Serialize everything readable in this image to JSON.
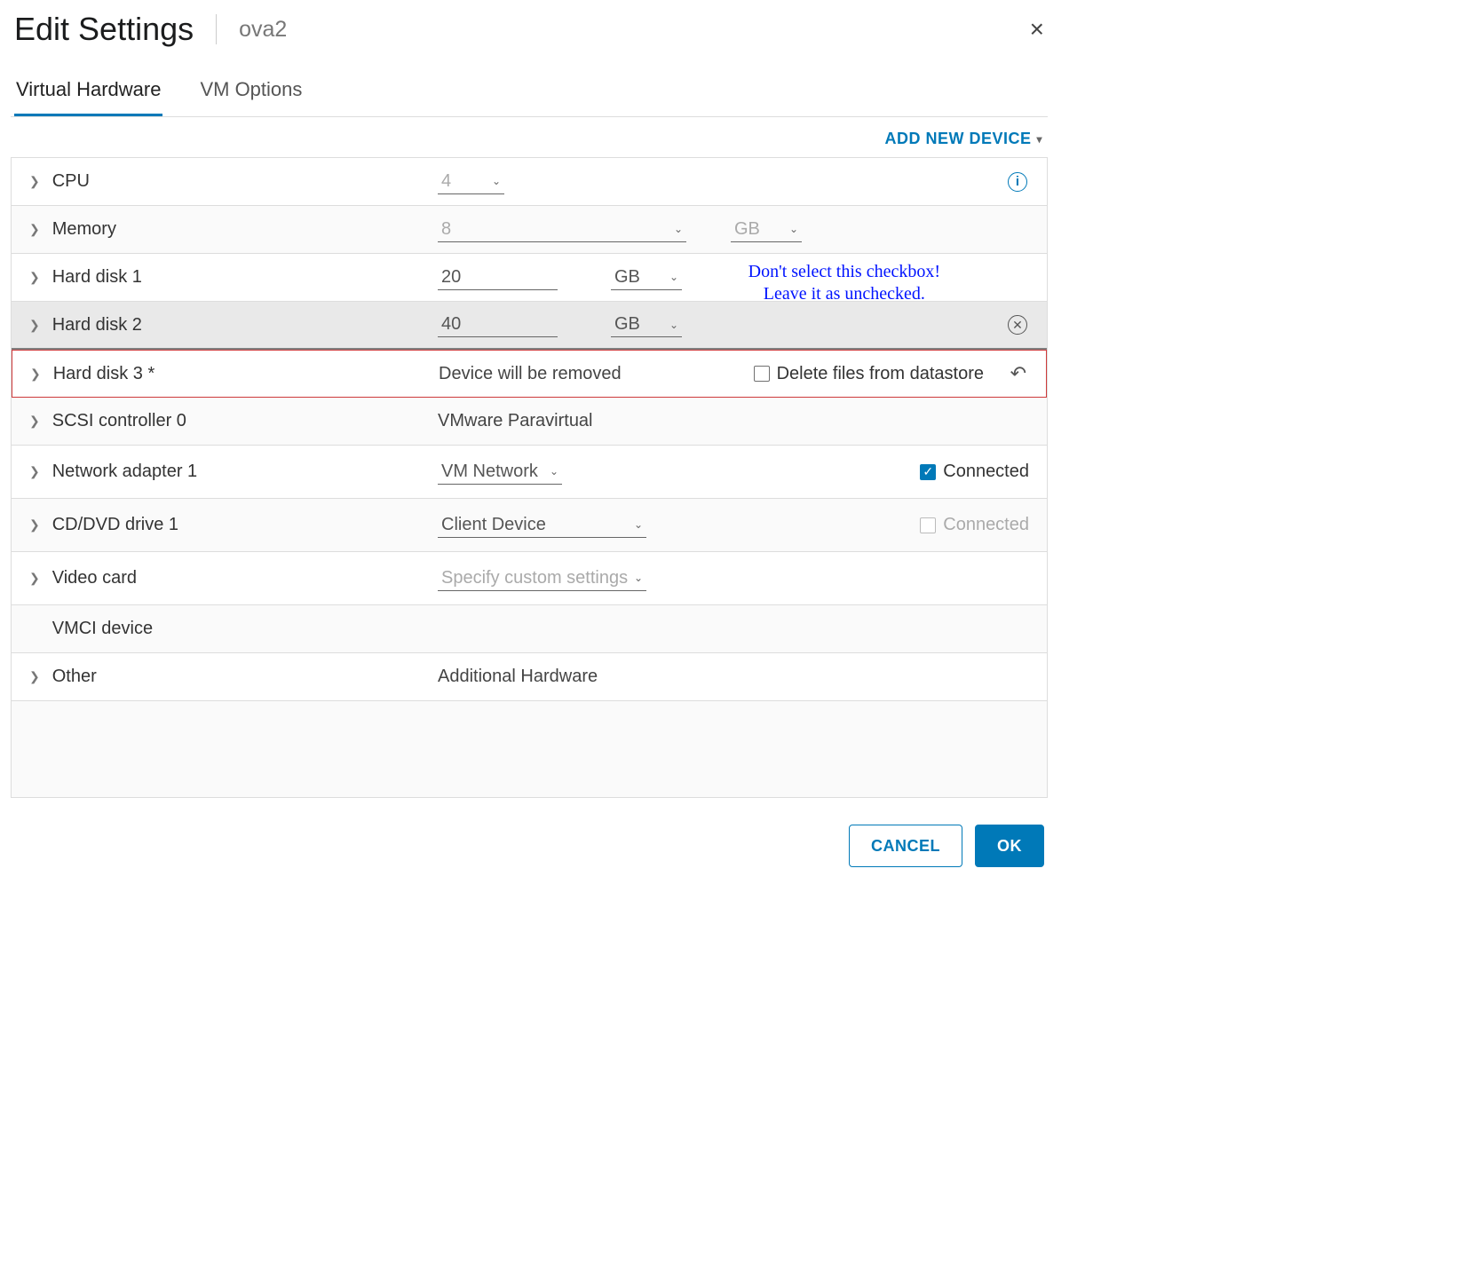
{
  "dialog": {
    "title": "Edit Settings",
    "subtitle": "ova2",
    "close_icon": "×"
  },
  "tabs": {
    "virtual_hardware": "Virtual Hardware",
    "vm_options": "VM Options"
  },
  "topbar": {
    "add_device": "ADD NEW DEVICE"
  },
  "annotation": {
    "line1": "Don't select this checkbox!",
    "line2": "Leave it as unchecked."
  },
  "rows": {
    "cpu": {
      "label": "CPU",
      "value": "4"
    },
    "memory": {
      "label": "Memory",
      "value": "8",
      "unit": "GB"
    },
    "hd1": {
      "label": "Hard disk 1",
      "value": "20",
      "unit": "GB"
    },
    "hd2": {
      "label": "Hard disk 2",
      "value": "40",
      "unit": "GB"
    },
    "hd3": {
      "label": "Hard disk 3 *",
      "status": "Device will be removed",
      "delete_label": "Delete files from datastore"
    },
    "scsi": {
      "label": "SCSI controller 0",
      "value": "VMware Paravirtual"
    },
    "net": {
      "label": "Network adapter 1",
      "value": "VM Network",
      "connected_label": "Connected"
    },
    "cd": {
      "label": "CD/DVD drive 1",
      "value": "Client Device",
      "connected_label": "Connected"
    },
    "video": {
      "label": "Video card",
      "value": "Specify custom settings"
    },
    "vmci": {
      "label": "VMCI device"
    },
    "other": {
      "label": "Other",
      "value": "Additional Hardware"
    }
  },
  "footer": {
    "cancel": "CANCEL",
    "ok": "OK"
  }
}
